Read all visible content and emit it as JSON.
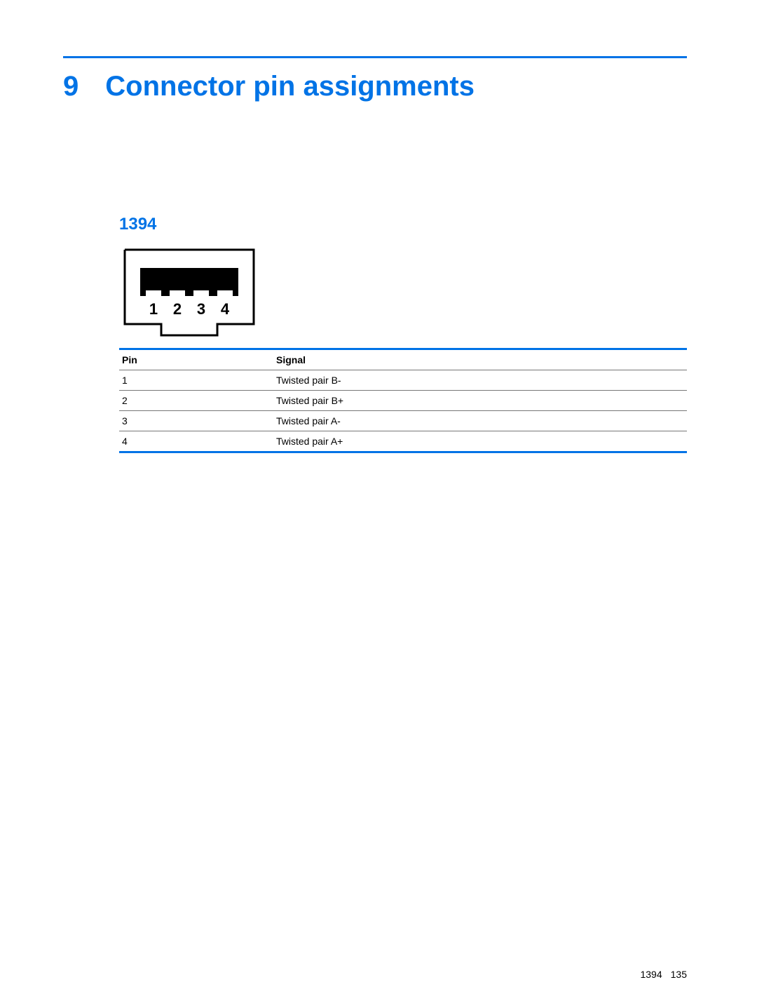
{
  "chapter": {
    "number": "9",
    "title": "Connector pin assignments"
  },
  "section": {
    "title": "1394"
  },
  "diagram": {
    "pin_labels": [
      "1",
      "2",
      "3",
      "4"
    ]
  },
  "table": {
    "headers": {
      "pin": "Pin",
      "signal": "Signal"
    },
    "rows": [
      {
        "pin": "1",
        "signal": "Twisted pair B-"
      },
      {
        "pin": "2",
        "signal": "Twisted pair B+"
      },
      {
        "pin": "3",
        "signal": "Twisted pair A-"
      },
      {
        "pin": "4",
        "signal": "Twisted pair A+"
      }
    ]
  },
  "footer": {
    "section": "1394",
    "page": "135"
  }
}
